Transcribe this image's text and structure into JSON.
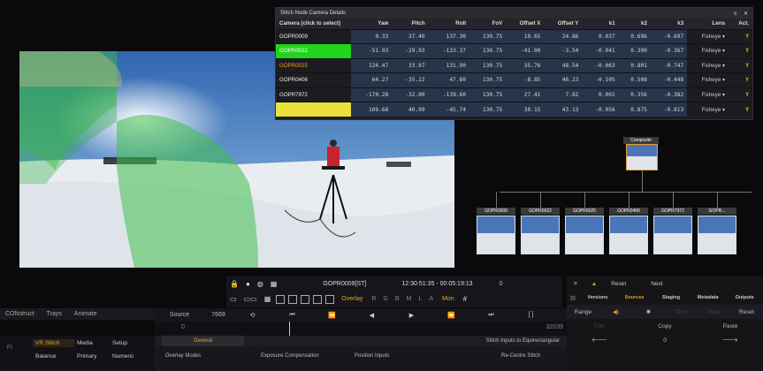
{
  "colors": {
    "accent_orange": "#e8a030",
    "select_green": "#21d41c",
    "select_yellow": "#e8e23a",
    "numeric_cell_bg": "#27354a"
  },
  "camera_panel": {
    "title": "Stitch Node Camera Details",
    "headers": [
      "Camera (click to select)",
      "Yaw",
      "Pitch",
      "Roll",
      "FoV",
      "Offset X",
      "Offset Y",
      "k1",
      "k2",
      "k3",
      "Lens",
      "Act."
    ],
    "rows": [
      {
        "camera": "GOPR0009",
        "yaw": "9.33",
        "pitch": "37.40",
        "roll": "137.30",
        "fov": "130.75",
        "ox": "10.65",
        "oy": "24.86",
        "k1": "0.037",
        "k2": "0.696",
        "k3": "-0.697",
        "lens": "Fisheye ▾",
        "act": "Y"
      },
      {
        "camera": "GOPR0022",
        "yaw": "-51.93",
        "pitch": "-29.93",
        "roll": "-133.37",
        "fov": "130.75",
        "ox": "-41.00",
        "oy": "-3.54",
        "k1": "-0.041",
        "k2": "0.390",
        "k3": "-0.367",
        "lens": "Fisheye ▾",
        "act": "Y"
      },
      {
        "camera": "GOPR0025",
        "yaw": "124.47",
        "pitch": "33.97",
        "roll": "131.90",
        "fov": "130.75",
        "ox": "35.76",
        "oy": "48.54",
        "k1": "-0.063",
        "k2": "0.801",
        "k3": "-0.747",
        "lens": "Fisheye ▾",
        "act": "Y"
      },
      {
        "camera": "GOPR0406",
        "yaw": "64.27",
        "pitch": "-35.22",
        "roll": "47.80",
        "fov": "130.75",
        "ox": "-8.85",
        "oy": "46.23",
        "k1": "-0.105",
        "k2": "0.508",
        "k3": "-0.448",
        "lens": "Fisheye ▾",
        "act": "Y"
      },
      {
        "camera": "GOPR7972",
        "yaw": "-170.28",
        "pitch": "-32.00",
        "roll": "-139.60",
        "fov": "130.75",
        "ox": "27.41",
        "oy": "7.82",
        "k1": "0.002",
        "k2": "0.356",
        "k3": "-0.382",
        "lens": "Fisheye ▾",
        "act": "Y"
      },
      {
        "camera": "",
        "yaw": "109.68",
        "pitch": "40.09",
        "roll": "-45.74",
        "fov": "130.75",
        "ox": "30.15",
        "oy": "43.13",
        "k1": "-0.056",
        "k2": "0.875",
        "k3": "-0.813",
        "lens": "Fisheye ▾",
        "act": "Y"
      }
    ]
  },
  "node_graph": {
    "parent": "Composite",
    "children": [
      "GOPR0009",
      "GOPR0022",
      "GOPR0025",
      "GOPR0406",
      "GOPR7972",
      "GOPR..."
    ]
  },
  "transport": {
    "clip": "GOPR0009[ST]",
    "timecode": "12:30:51:35 - 00:05:19:13",
    "count": "0",
    "overlay": "Overlay",
    "channels": [
      "R",
      "G",
      "B",
      "M",
      "L",
      "A"
    ],
    "mon": "Mon"
  },
  "left_tabs": [
    "CONstruct",
    "Trays",
    "Animate"
  ],
  "timeline": {
    "source": "Source",
    "frames": "7669",
    "start": "0",
    "end": "32039"
  },
  "right_panel": {
    "reset": "Reset",
    "next": "Next",
    "tabs": [
      "Versions",
      "Sources",
      "Staging",
      "Metadata",
      "Outputs"
    ],
    "range": "Range",
    "range_buttons": [
      "Trim",
      "Prev",
      "Reset"
    ],
    "row2": [
      "Trim",
      "Copy",
      "Paste"
    ],
    "row3_value": "0"
  },
  "bottom_left": {
    "fi": "FI",
    "tabs": [
      "VR Stitch",
      "Media",
      "Setup",
      "Balance",
      "Primary",
      "Numeric"
    ]
  },
  "bottom_center": {
    "general": "General",
    "stitch_inputs": "Stitch Inputs to Equirectangular",
    "labels": [
      "Overlay Modes",
      "Exposure Compensation",
      "Position Inputs",
      "Re-Centre Stitch"
    ]
  }
}
